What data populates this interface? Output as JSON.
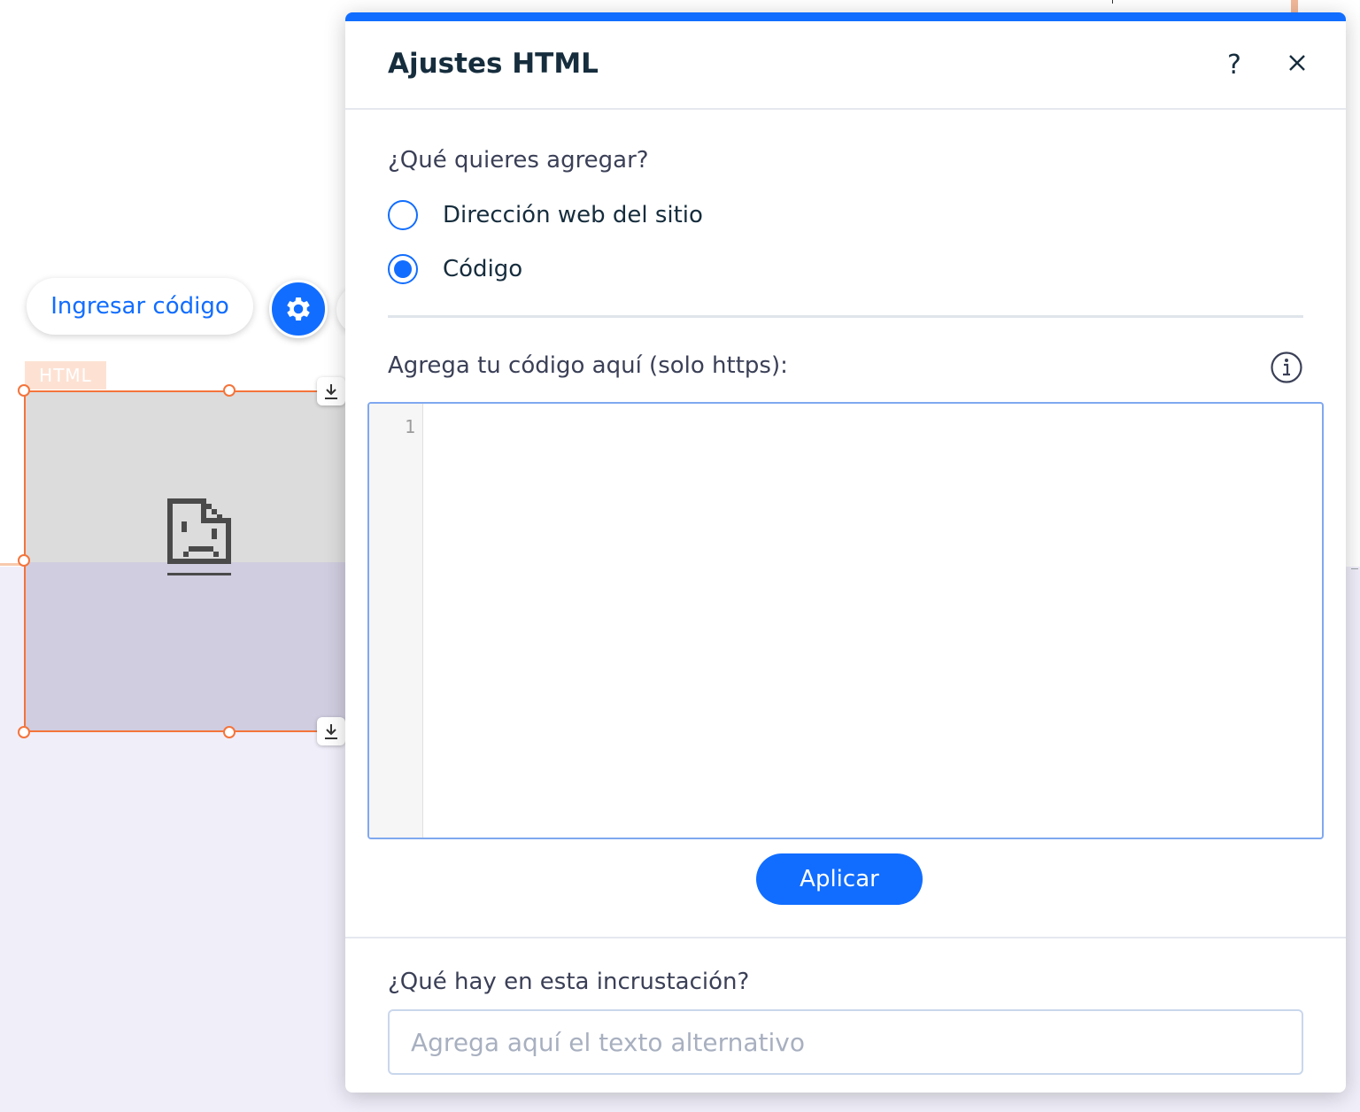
{
  "toolbar": {
    "enter_code_label": "Ingresar código",
    "settings_icon": "gear-icon"
  },
  "element": {
    "tag_label": "HTML",
    "placeholder_icon": "broken-file-icon"
  },
  "panel": {
    "title": "Ajustes HTML",
    "help_label": "?",
    "close_icon": "close-icon",
    "question": "¿Qué quieres agregar?",
    "options": [
      {
        "label": "Dirección web del sitio",
        "checked": false
      },
      {
        "label": "Código",
        "checked": true
      }
    ],
    "code_label": "Agrega tu código aquí (solo https):",
    "info_icon": "info-icon",
    "code_editor": {
      "line_numbers": [
        "1"
      ],
      "content": ""
    },
    "apply_label": "Aplicar",
    "alt_question": "¿Qué hay en esta incrustación?",
    "alt_placeholder": "Agrega aquí el texto alternativo",
    "alt_value": ""
  },
  "colors": {
    "accent": "#116dff",
    "selection": "#f4743b",
    "canvas_lower": "#f0eef9"
  }
}
